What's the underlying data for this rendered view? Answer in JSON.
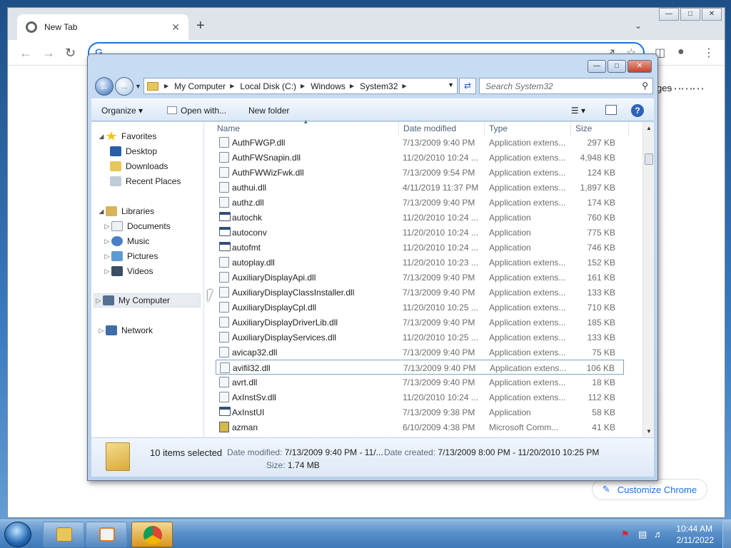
{
  "chrome": {
    "tab_title": "New Tab",
    "tab_close": "✕",
    "new_tab": "+",
    "images_link": "ges",
    "customize_label": "Customize Chrome"
  },
  "explorer": {
    "breadcrumbs": [
      "My Computer",
      "Local Disk (C:)",
      "Windows",
      "System32"
    ],
    "search_placeholder": "Search System32",
    "commands": {
      "organize": "Organize",
      "open_with": "Open with...",
      "new_folder": "New folder"
    },
    "navpane": {
      "favorites": "Favorites",
      "desktop": "Desktop",
      "downloads": "Downloads",
      "recent_places": "Recent Places",
      "libraries": "Libraries",
      "documents": "Documents",
      "music": "Music",
      "pictures": "Pictures",
      "videos": "Videos",
      "my_computer": "My Computer",
      "network": "Network"
    },
    "columns": {
      "name": "Name",
      "date_modified": "Date modified",
      "type": "Type",
      "size": "Size"
    },
    "files": [
      {
        "name": "AuthFWGP.dll",
        "date": "7/13/2009 9:40 PM",
        "type": "Application extens...",
        "size": "297 KB",
        "kind": "dll"
      },
      {
        "name": "AuthFWSnapin.dll",
        "date": "11/20/2010 10:24 ...",
        "type": "Application extens...",
        "size": "4,948 KB",
        "kind": "dll"
      },
      {
        "name": "AuthFWWizFwk.dll",
        "date": "7/13/2009 9:54 PM",
        "type": "Application extens...",
        "size": "124 KB",
        "kind": "dll"
      },
      {
        "name": "authui.dll",
        "date": "4/11/2019 11:37 PM",
        "type": "Application extens...",
        "size": "1,897 KB",
        "kind": "dll"
      },
      {
        "name": "authz.dll",
        "date": "7/13/2009 9:40 PM",
        "type": "Application extens...",
        "size": "174 KB",
        "kind": "dll"
      },
      {
        "name": "autochk",
        "date": "11/20/2010 10:24 ...",
        "type": "Application",
        "size": "760 KB",
        "kind": "app"
      },
      {
        "name": "autoconv",
        "date": "11/20/2010 10:24 ...",
        "type": "Application",
        "size": "775 KB",
        "kind": "app"
      },
      {
        "name": "autofmt",
        "date": "11/20/2010 10:24 ...",
        "type": "Application",
        "size": "746 KB",
        "kind": "app"
      },
      {
        "name": "autoplay.dll",
        "date": "11/20/2010 10:23 ...",
        "type": "Application extens...",
        "size": "152 KB",
        "kind": "dll"
      },
      {
        "name": "AuxiliaryDisplayApi.dll",
        "date": "7/13/2009 9:40 PM",
        "type": "Application extens...",
        "size": "161 KB",
        "kind": "dll"
      },
      {
        "name": "AuxiliaryDisplayClassInstaller.dll",
        "date": "7/13/2009 9:40 PM",
        "type": "Application extens...",
        "size": "133 KB",
        "kind": "dll"
      },
      {
        "name": "AuxiliaryDisplayCpl.dll",
        "date": "11/20/2010 10:25 ...",
        "type": "Application extens...",
        "size": "710 KB",
        "kind": "dll"
      },
      {
        "name": "AuxiliaryDisplayDriverLib.dll",
        "date": "7/13/2009 9:40 PM",
        "type": "Application extens...",
        "size": "185 KB",
        "kind": "dll"
      },
      {
        "name": "AuxiliaryDisplayServices.dll",
        "date": "11/20/2010 10:25 ...",
        "type": "Application extens...",
        "size": "133 KB",
        "kind": "dll"
      },
      {
        "name": "avicap32.dll",
        "date": "7/13/2009 9:40 PM",
        "type": "Application extens...",
        "size": "75 KB",
        "kind": "dll"
      },
      {
        "name": "avifil32.dll",
        "date": "7/13/2009 9:40 PM",
        "type": "Application extens...",
        "size": "106 KB",
        "kind": "dll",
        "selected": true
      },
      {
        "name": "avrt.dll",
        "date": "7/13/2009 9:40 PM",
        "type": "Application extens...",
        "size": "18 KB",
        "kind": "dll"
      },
      {
        "name": "AxInstSv.dll",
        "date": "11/20/2010 10:24 ...",
        "type": "Application extens...",
        "size": "112 KB",
        "kind": "dll"
      },
      {
        "name": "AxInstUI",
        "date": "7/13/2009 9:38 PM",
        "type": "Application",
        "size": "58 KB",
        "kind": "app"
      },
      {
        "name": "azman",
        "date": "6/10/2009 4:38 PM",
        "type": "Microsoft Comm...",
        "size": "41 KB",
        "kind": "msc"
      }
    ],
    "details": {
      "selected_count": "10 items selected",
      "date_modified_label": "Date modified:",
      "date_modified_value": "7/13/2009 9:40 PM - 11/...",
      "date_created_label": "Date created:",
      "date_created_value": "7/13/2009 8:00 PM - 11/20/2010 10:25 PM",
      "size_label": "Size:",
      "size_value": "1.74 MB"
    }
  },
  "taskbar": {
    "time": "10:44 AM",
    "date": "2/11/2022"
  }
}
